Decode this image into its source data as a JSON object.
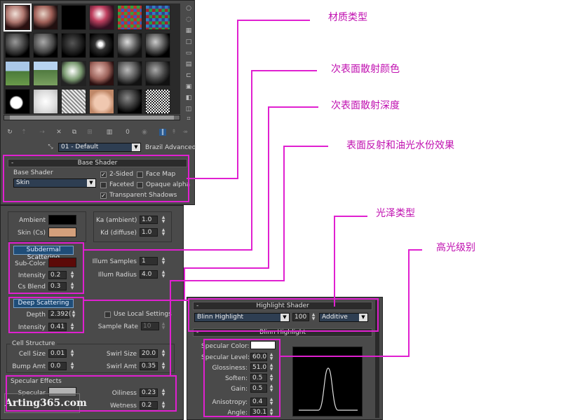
{
  "annotations": {
    "material_type": "材质类型",
    "sss_color": "次表面散射颜色",
    "sss_depth": "次表面散射深度",
    "reflection": "表面反射和油光水份效果",
    "gloss_type": "光泽类型",
    "highlight_level": "高光级别"
  },
  "editor": {
    "material_name": "01 - Default",
    "material_type": "Brazil Advanced",
    "side_icons": [
      "sphere-icon",
      "cylinder-icon",
      "checker-icon",
      "box-icon",
      "background-icon",
      "sample-uv-icon",
      "video-check-icon",
      "make-preview-icon",
      "options-icon",
      "select-by-material-icon",
      "material-navigator-icon"
    ],
    "toolbar_icons": [
      "get-material-icon",
      "put-to-scene-icon",
      "assign-icon",
      "reset-icon",
      "copy-icon",
      "unique-icon",
      "put-library-icon",
      "effects-channel-icon",
      "show-map-icon",
      "show-end-result-icon",
      "go-parent-icon",
      "go-sibling-icon"
    ],
    "effects_channel": "0"
  },
  "base_shader": {
    "title": "Base Shader",
    "label": "Base Shader",
    "value": "Skin",
    "two_sided": "2-Sided",
    "face_map": "Face Map",
    "faceted": "Faceted",
    "opaque_alpha": "Opaque alpha",
    "transparent_shadows": "Transparent Shadows"
  },
  "skin": {
    "ambient_label": "Ambient",
    "skin_label": "Skin (Cs)",
    "ka_label": "Ka (ambient)",
    "ka_value": "1.0",
    "kd_label": "Kd (diffuse)",
    "kd_value": "1.0",
    "ambient_color": "#000000",
    "skin_color": "#d4a07c"
  },
  "subdermal": {
    "title": "Subdermal Scattering",
    "subcolor_label": "Sub-Color",
    "subcolor": "#5c0a08",
    "intensity_label": "Intensity",
    "intensity": "0.2",
    "blend_label": "Cs Blend",
    "blend": "0.3",
    "illum_samples_label": "Illum Samples",
    "illum_samples": "1",
    "illum_radius_label": "Illum Radius",
    "illum_radius": "4.0"
  },
  "deep": {
    "title": "Deep Scattering",
    "depth_label": "Depth",
    "depth": "2.392(",
    "intensity_label": "Intensity",
    "intensity": "0.41",
    "local_label": "Use Local Settings",
    "sample_rate_label": "Sample Rate",
    "sample_rate": "10"
  },
  "cell": {
    "title": "Cell Structure",
    "cell_size_label": "Cell Size",
    "cell_size": "0.01",
    "bump_label": "Bump Amt",
    "bump": "0.0",
    "swirl_size_label": "Swirl Size",
    "swirl_size": "20.0",
    "swirl_amt_label": "Swirl Amt",
    "swirl_amt": "0.35"
  },
  "specular_effects": {
    "title": "Specular Effects",
    "specular_label": "Specular",
    "specular_color": "#b4b4b4",
    "oiliness_label": "Oiliness",
    "oiliness": "0.23",
    "wetness_label": "Wetness",
    "wetness": "0.2"
  },
  "highlight": {
    "title": "Highlight Shader",
    "shader": "Blinn Highlight",
    "value": "100",
    "mode": "Additive",
    "sub_title": "Blinn Highlight",
    "spec_color_label": "Specular Color:",
    "spec_color": "#ffffff",
    "level_label": "Specular Level:",
    "level": "60.0",
    "gloss_label": "Glossiness:",
    "gloss": "51.0",
    "soften_label": "Soften:",
    "soften": "0.5",
    "gain_label": "Gain:",
    "gain": "0.5",
    "aniso_label": "Anisotropy:",
    "aniso": "0.4",
    "angle_label": "Angle:",
    "angle": "30.1"
  },
  "watermark": "Arting365.com"
}
